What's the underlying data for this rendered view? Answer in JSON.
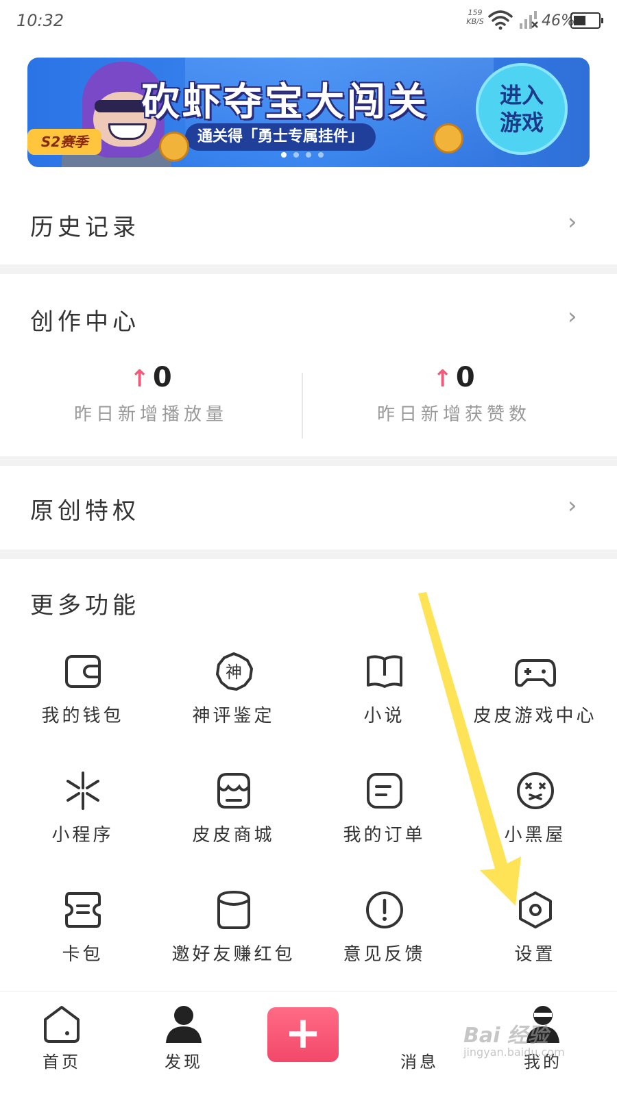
{
  "status_bar": {
    "time": "10:32",
    "net_speed_value": "159",
    "net_speed_unit": "KB/S",
    "battery": "46%"
  },
  "banner": {
    "title": "砍虾夺宝大闯关",
    "subtitle": "通关得「勇士专属挂件」",
    "season_badge": "S2赛季",
    "enter_line1": "进入",
    "enter_line2": "游戏",
    "page_count": 4,
    "active_page": 1
  },
  "history": {
    "title": "历史记录"
  },
  "creator_center": {
    "title": "创作中心",
    "stats": [
      {
        "value": "0",
        "label": "昨日新增播放量"
      },
      {
        "value": "0",
        "label": "昨日新增获赞数"
      }
    ]
  },
  "original_privilege": {
    "title": "原创特权"
  },
  "more_functions": {
    "title": "更多功能",
    "items": [
      {
        "label": "我的钱包",
        "icon": "wallet-icon"
      },
      {
        "label": "神评鉴定",
        "icon": "god-comment-icon",
        "glyph": "神"
      },
      {
        "label": "小说",
        "icon": "book-icon"
      },
      {
        "label": "皮皮游戏中心",
        "icon": "gamepad-icon"
      },
      {
        "label": "小程序",
        "icon": "mini-program-icon"
      },
      {
        "label": "皮皮商城",
        "icon": "shop-icon"
      },
      {
        "label": "我的订单",
        "icon": "order-icon"
      },
      {
        "label": "小黑屋",
        "icon": "sad-face-icon"
      },
      {
        "label": "卡包",
        "icon": "card-pack-icon"
      },
      {
        "label": "邀好友赚红包",
        "icon": "invite-icon"
      },
      {
        "label": "意见反馈",
        "icon": "feedback-icon"
      },
      {
        "label": "设置",
        "icon": "settings-icon"
      }
    ]
  },
  "bottom_nav": {
    "items": [
      {
        "label": "首页",
        "icon": "home-icon"
      },
      {
        "label": "发现",
        "icon": "discover-person-icon"
      },
      {
        "label": "",
        "icon": "plus-icon"
      },
      {
        "label": "消息",
        "icon": "message-icon"
      },
      {
        "label": "我的",
        "icon": "profile-icon"
      }
    ]
  },
  "watermark": {
    "main": "Bai 经验",
    "sub": "jingyan.baidu.com"
  },
  "colors": {
    "accent_pink": "#f2486a",
    "arrow_red": "#f45b7a",
    "annotation_yellow": "#ffe14d",
    "banner_blue": "#3a86ef"
  }
}
